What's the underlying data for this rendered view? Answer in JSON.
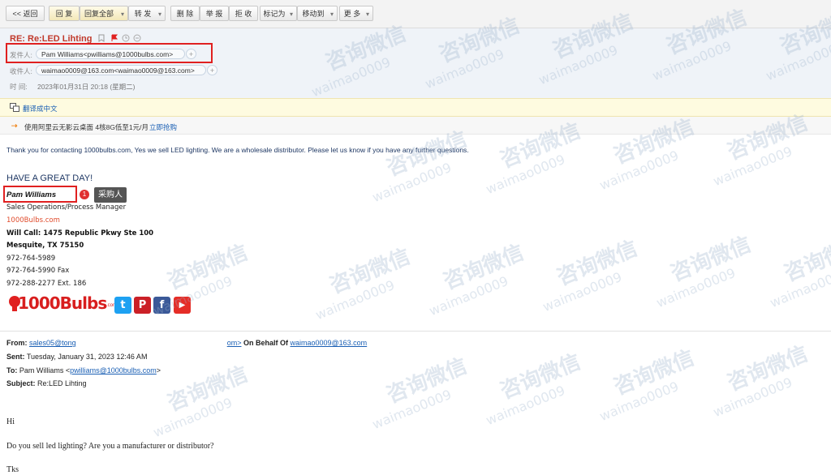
{
  "toolbar": {
    "back": "<< 返回",
    "reply": "回 复",
    "reply_all": "回复全部",
    "forward": "转 发",
    "delete": "删 除",
    "report": "举 报",
    "reject": "拒 收",
    "mark_as": "标记为",
    "move_to": "移动到",
    "more": "更 多"
  },
  "header": {
    "subject": "RE: Re:LED Lihting",
    "from_label": "发件人:",
    "from_value": "Pam Williams<pwilliams@1000bulbs.com>",
    "to_label": "收件人:",
    "to_value": "waimao0009@163.com<waimao0009@163.com>",
    "time_label": "时 间:",
    "time_value": "2023年01月31日 20:18 (星期二)"
  },
  "translate": {
    "label": "翻译成中文"
  },
  "ad": {
    "text": "使用阿里云无影云桌面 4核8G低至1元/月",
    "link": "立即抢购"
  },
  "body": {
    "intro": "Thank you for contacting 1000bulbs.com, Yes we sell LED lighting. We are a wholesale distributor. Please let us know if you have any further questions.",
    "greeting": "HAVE A GREAT DAY!",
    "sig_name": "Pam Williams",
    "sig_title": "Sales Operations/Process Manager",
    "sig_site": "1000Bulbs.com",
    "sig_addr1": "Will Call: 1475 Republic Pkwy Ste 100",
    "sig_addr2": "Mesquite, TX 75150",
    "sig_phone": "972-764-5989",
    "sig_fax": "972-764-5990 Fax",
    "sig_ext": "972-288-2277 Ext. 186",
    "logo": "1000Bulbs",
    "logo_suffix": ".com"
  },
  "annotation": {
    "number": "1",
    "label": "采购人"
  },
  "quoted": {
    "from_label": "From:",
    "from_value_part1": "sales05@tong",
    "from_value_part2": "om>",
    "behalf": " On Behalf Of ",
    "behalf_email": "waimao0009@163.com",
    "sent_label": "Sent:",
    "sent_value": " Tuesday, January 31, 2023 12:46 AM",
    "to_label": "To:",
    "to_value": " Pam Williams <",
    "to_email": "pwilliams@1000bulbs.com",
    "to_end": ">",
    "subject_label": "Subject:",
    "subject_value": " Re:LED Lihting",
    "line1": "Hi",
    "line2": "Do you sell led lighting? Are you a manufacturer or distributor?",
    "line3": "Tks"
  },
  "watermark": {
    "cn": "咨询微信",
    "en": "waimao0009"
  },
  "icons": {
    "twitter": "t",
    "pinterest": "P",
    "facebook": "f",
    "youtube": "▶"
  },
  "colors": {
    "subject": "#c0392b",
    "annotation_box": "#e02020",
    "twitter": "#1da1f2",
    "pinterest": "#cb2027",
    "facebook": "#3b5998",
    "youtube": "#e52d27",
    "link": "#1a5fb4"
  }
}
